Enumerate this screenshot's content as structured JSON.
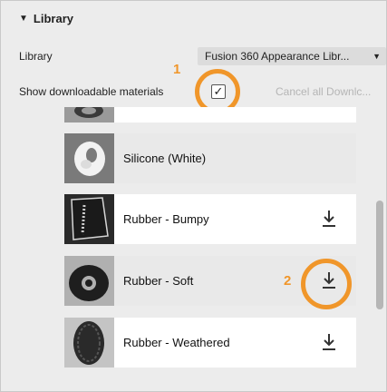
{
  "library_section": {
    "header": "Library",
    "library_label": "Library",
    "library_value": "Fusion 360 Appearance Libr...",
    "show_downloadable_label": "Show downloadable materials",
    "show_downloadable_checked": true,
    "cancel_label": "Cancel all Downlc..."
  },
  "materials": [
    {
      "name": "Silicone (White)",
      "downloadable": false
    },
    {
      "name": "Rubber - Bumpy",
      "downloadable": true
    },
    {
      "name": "Rubber - Soft",
      "downloadable": true
    },
    {
      "name": "Rubber - Weathered",
      "downloadable": true
    }
  ],
  "callouts": {
    "one": "1",
    "two": "2"
  },
  "colors": {
    "accent": "#f0962a"
  }
}
